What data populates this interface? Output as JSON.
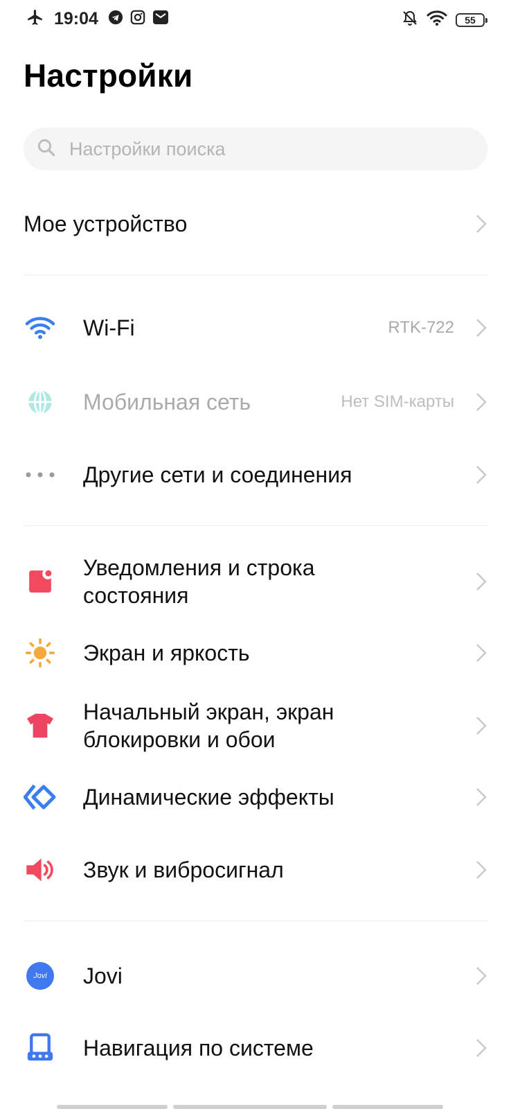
{
  "status_bar": {
    "time": "19:04",
    "battery": "55",
    "icons": [
      "airplane-icon",
      "telegram-icon",
      "instagram-icon",
      "mail-icon",
      "bell-off-icon",
      "wifi-icon",
      "battery-icon"
    ]
  },
  "header": {
    "title": "Настройки"
  },
  "search": {
    "placeholder": "Настройки поиска"
  },
  "items": {
    "my_device": {
      "label": "Мое устройство"
    },
    "wifi": {
      "label": "Wi-Fi",
      "value": "RTK-722",
      "icon": "wifi-icon",
      "color": "#3b7ef0"
    },
    "mobile": {
      "label": "Мобильная сеть",
      "value": "Нет SIM-карты",
      "icon": "globe-icon",
      "color": "#9ee3dd"
    },
    "other": {
      "label": "Другие сети и соединения",
      "icon": "more-dots-icon",
      "color": "#9a9a9a"
    },
    "notifications": {
      "label": "Уведомления и строка состояния",
      "icon": "notification-icon",
      "color": "#f2495e"
    },
    "display": {
      "label": "Экран и яркость",
      "icon": "sun-icon",
      "color": "#f7a83a"
    },
    "home": {
      "label": "Начальный экран, экран блокировки и обои",
      "icon": "tshirt-icon",
      "color": "#ef4461"
    },
    "effects": {
      "label": "Динамические эффекты",
      "icon": "diamond-icon",
      "color": "#3b7ef0"
    },
    "sound": {
      "label": "Звук и вибросигнал",
      "icon": "speaker-icon",
      "color": "#f2495e"
    },
    "jovi": {
      "label": "Jovi",
      "badge": "Jovi",
      "icon": "jovi-icon",
      "color": "#3f78ef"
    },
    "navigation": {
      "label": "Навигация по системе",
      "icon": "navigation-icon",
      "color": "#3f78ef"
    }
  }
}
